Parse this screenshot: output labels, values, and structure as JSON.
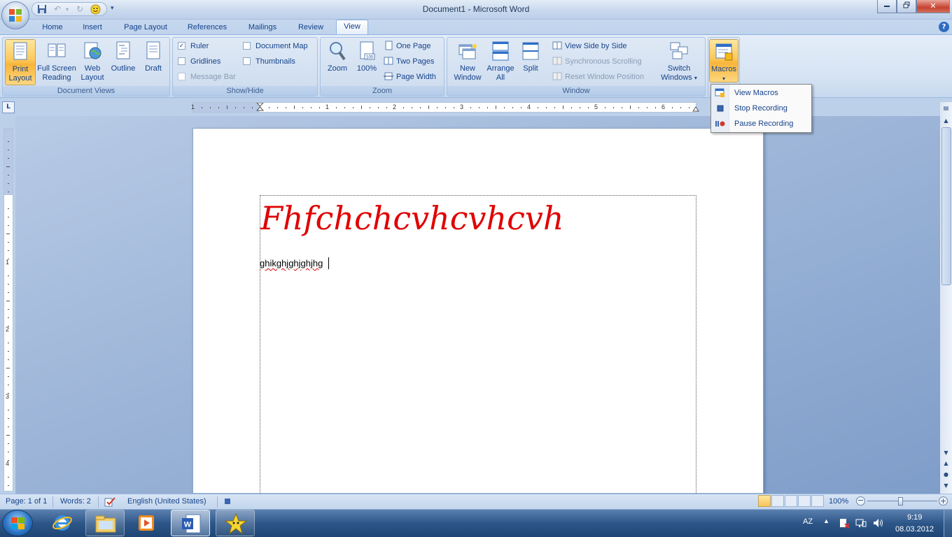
{
  "window": {
    "title": "Document1 - Microsoft Word"
  },
  "tabs": [
    "Home",
    "Insert",
    "Page Layout",
    "References",
    "Mailings",
    "Review",
    "View"
  ],
  "active_tab": "View",
  "ribbon": {
    "document_views": {
      "label": "Document Views",
      "buttons": [
        {
          "line1": "Print",
          "line2": "Layout",
          "selected": true
        },
        {
          "line1": "Full Screen",
          "line2": "Reading"
        },
        {
          "line1": "Web",
          "line2": "Layout"
        },
        {
          "line1": "Outline",
          "line2": ""
        },
        {
          "line1": "Draft",
          "line2": ""
        }
      ]
    },
    "show_hide": {
      "label": "Show/Hide",
      "ruler": "Ruler",
      "ruler_checked": true,
      "gridlines": "Gridlines",
      "message_bar": "Message Bar",
      "document_map": "Document Map",
      "thumbnails": "Thumbnails"
    },
    "zoom": {
      "label": "Zoom",
      "zoom_btn": "Zoom",
      "hundred": "100%",
      "hundred_icon_text": "100",
      "one_page": "One Page",
      "two_pages": "Two Pages",
      "page_width": "Page Width"
    },
    "window": {
      "label": "Window",
      "new_window_1": "New",
      "new_window_2": "Window",
      "arrange_1": "Arrange",
      "arrange_2": "All",
      "split": "Split",
      "side_by_side": "View Side by Side",
      "sync_scroll": "Synchronous Scrolling",
      "reset_pos": "Reset Window Position",
      "switch_1": "Switch",
      "switch_2": "Windows"
    },
    "macros": {
      "label": "Macros"
    }
  },
  "macro_menu": [
    {
      "label": "View Macros",
      "icon": "view-macros-icon"
    },
    {
      "label": "Stop Recording",
      "icon": "stop-icon"
    },
    {
      "label": "Pause Recording",
      "icon": "pause-record-icon"
    }
  ],
  "ruler": {
    "numbers": [
      "1",
      "1",
      "2",
      "3",
      "4",
      "5",
      "6"
    ],
    "vnumbers": [
      "1",
      "2",
      "3",
      "4"
    ]
  },
  "document": {
    "heading": "Fhfchchcvhcvhcvh",
    "body": "ghikghjghjghjhg"
  },
  "status": {
    "page": "Page: 1 of 1",
    "words": "Words: 2",
    "language": "English (United States)",
    "zoom": "100%"
  },
  "taskbar": {
    "lang": "AZ",
    "time": "9:19",
    "date": "08.03.2012"
  },
  "colors": {
    "heading": "#e00000",
    "accent": "#15428b"
  }
}
